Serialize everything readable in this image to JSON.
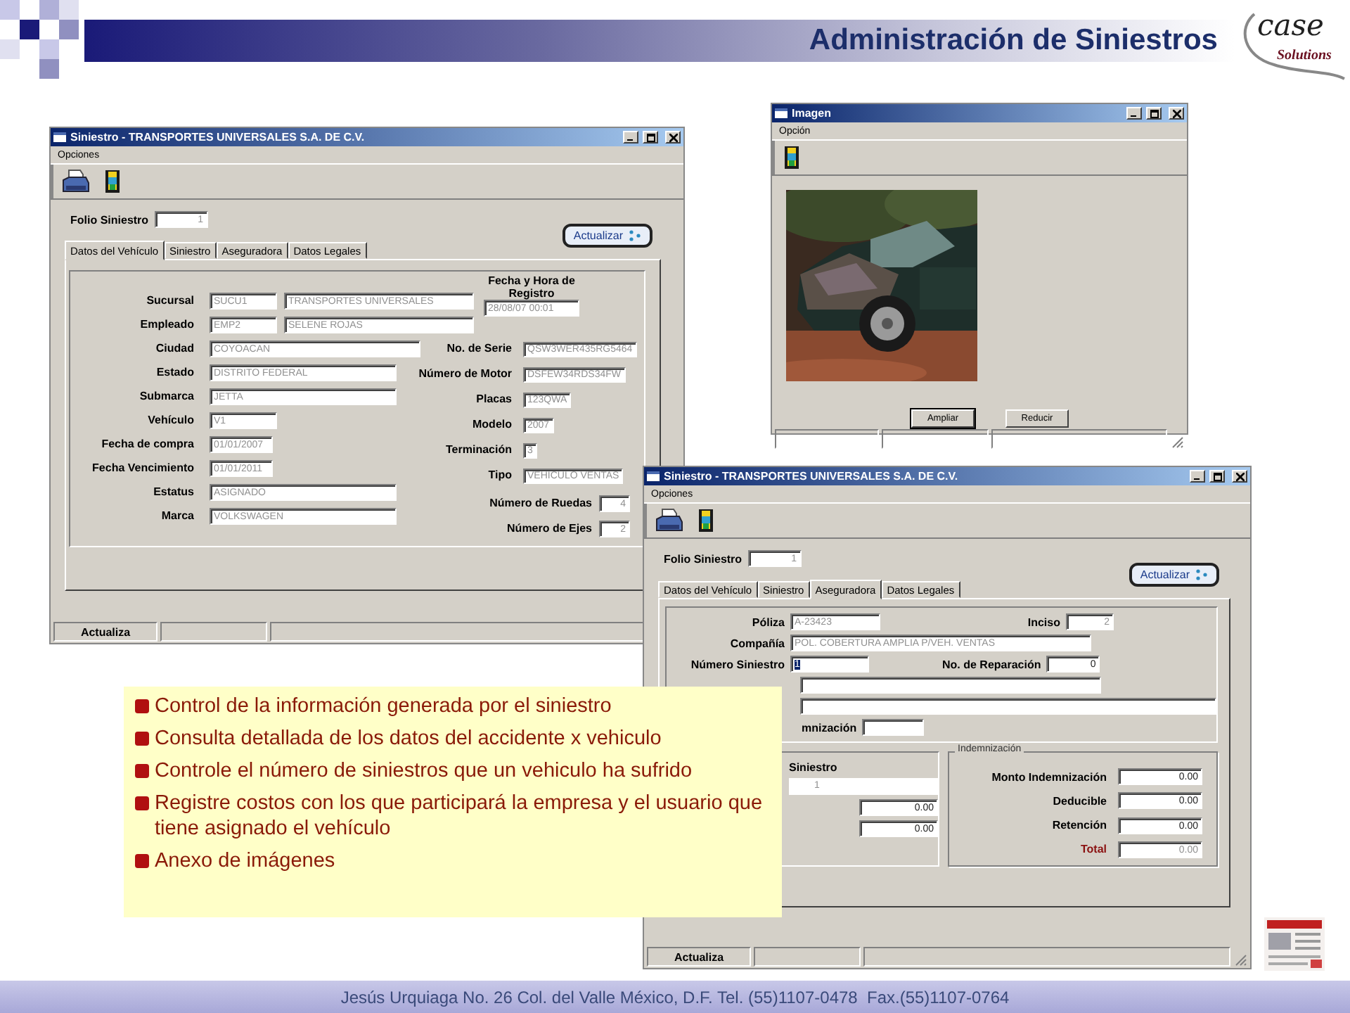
{
  "header": {
    "title": "Administración de Siniestros",
    "logo_word": "case",
    "logo_tagline": "Solutions"
  },
  "vehicle_window": {
    "title": "Siniestro - TRANSPORTES UNIVERSALES S.A. DE C.V.",
    "menu": [
      "Opciones"
    ],
    "folio_label": "Folio Siniestro",
    "folio": "1",
    "action_button": "Actualizar",
    "tabs": [
      {
        "label": "Datos del Vehículo",
        "selected": true
      },
      {
        "label": "Siniestro",
        "selected": false
      },
      {
        "label": "Aseguradora",
        "selected": false
      },
      {
        "label": "Datos Legales",
        "selected": false
      }
    ],
    "left_fields": [
      {
        "label": "Sucursal",
        "values": [
          "SUCU1",
          "TRANSPORTES UNIVERSALES"
        ]
      },
      {
        "label": "Empleado",
        "values": [
          "EMP2",
          "SELENE ROJAS"
        ]
      },
      {
        "label": "Ciudad",
        "values": [
          "COYOACAN"
        ]
      },
      {
        "label": "Estado",
        "values": [
          "DISTRITO FEDERAL"
        ]
      },
      {
        "label": "Submarca",
        "values": [
          "JETTA"
        ]
      },
      {
        "label": "Vehículo",
        "values": [
          "V1"
        ]
      },
      {
        "label": "Fecha de compra",
        "values": [
          "01/01/2007"
        ]
      },
      {
        "label": "Fecha Vencimiento",
        "values": [
          "01/01/2011"
        ]
      },
      {
        "label": "Estatus",
        "values": [
          "ASIGNADO"
        ]
      },
      {
        "label": "Marca",
        "values": [
          "VOLKSWAGEN"
        ]
      }
    ],
    "registration": {
      "label": "Fecha y Hora de Registro",
      "value": "28/08/07 00:01"
    },
    "right_fields": [
      {
        "label": "No. de Serie",
        "value": "QSW3WER435RG5464"
      },
      {
        "label": "Número de Motor",
        "value": "DSFEW34RDS34FW"
      },
      {
        "label": "Placas",
        "value": "123QWA"
      },
      {
        "label": "Modelo",
        "value": "2007"
      },
      {
        "label": "Terminación",
        "value": "3"
      },
      {
        "label": "Tipo",
        "value": "VEHICULO VENTAS"
      }
    ],
    "count_fields": [
      {
        "label": "Número de Ruedas",
        "value": "4"
      },
      {
        "label": "Número de Ejes",
        "value": "2"
      }
    ],
    "status_bar": [
      "Actualiza"
    ]
  },
  "image_window": {
    "title": "Imagen",
    "menu": [
      "Opción"
    ],
    "buttons": [
      "Ampliar",
      "Reducir"
    ]
  },
  "insurance_window": {
    "title": "Siniestro - TRANSPORTES UNIVERSALES S.A. DE C.V.",
    "menu": [
      "Opciones"
    ],
    "folio_label": "Folio Siniestro",
    "folio": "1",
    "action_button": "Actualizar",
    "tabs": [
      {
        "label": "Datos del Vehículo",
        "selected": false
      },
      {
        "label": "Siniestro",
        "selected": false
      },
      {
        "label": "Aseguradora",
        "selected": true
      },
      {
        "label": "Datos Legales",
        "selected": false
      }
    ],
    "poliza": {
      "label": "Póliza",
      "value": "A-23423"
    },
    "inciso": {
      "label": "Inciso",
      "value": "2"
    },
    "compania": {
      "label": "Compañía",
      "value": "POL. COBERTURA AMPLIA P/VEH. VENTAS"
    },
    "numero_siniestro": {
      "label": "Número Siniestro",
      "value": "1"
    },
    "reparacion": {
      "label": "No. de Reparación",
      "value": "0"
    },
    "partial_label": "mnización",
    "claim_column": {
      "header": "Siniestro",
      "value": "1",
      "amounts": [
        "0.00",
        "0.00"
      ]
    },
    "indemnity_group": {
      "title": "Indemnización",
      "rows": [
        {
          "label": "Monto Indemnización",
          "value": "0.00",
          "kind": "amount"
        },
        {
          "label": "Deducible",
          "value": "0.00",
          "kind": "amount"
        },
        {
          "label": "Retención",
          "value": "0.00",
          "kind": "amount"
        },
        {
          "label": "Total",
          "value": "0.00",
          "kind": "total"
        }
      ]
    },
    "status_bar": [
      "Actualiza"
    ]
  },
  "bullets": [
    "Control de la información generada por el siniestro",
    "Consulta detallada de los datos del accidente x vehiculo",
    "Controle el número de siniestros que un vehiculo ha sufrido",
    "Registre costos con los que participará la empresa y el usuario que tiene asignado el vehículo",
    "Anexo de imágenes"
  ],
  "footer": {
    "text": "Jesús Urquiaga No. 26 Col. del Valle México, D.F. Tel. (55)1107-0478  Fax.(55)1107-0764"
  }
}
